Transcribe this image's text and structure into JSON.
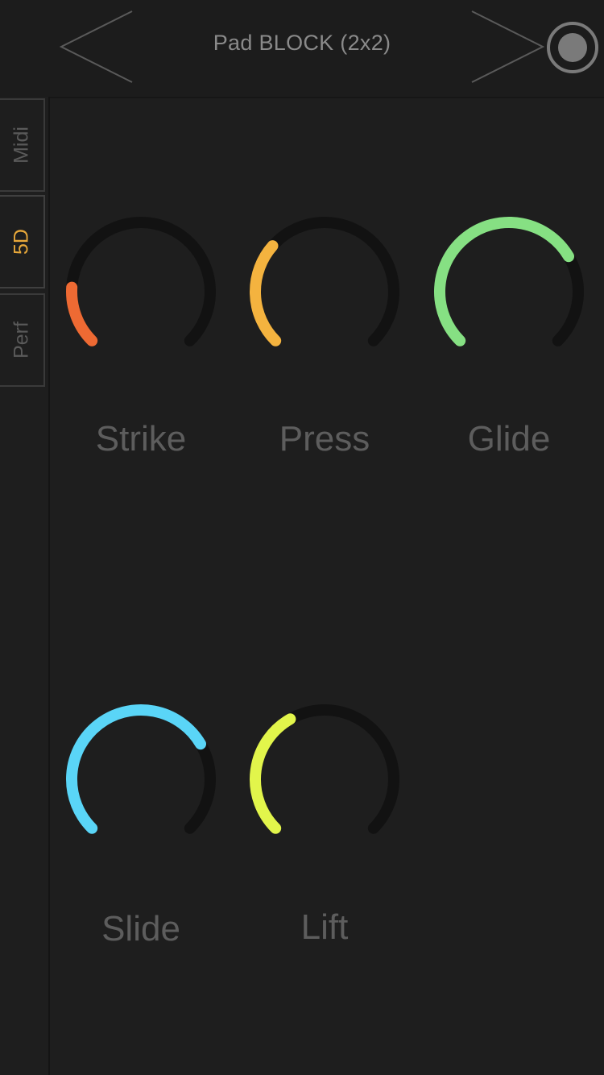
{
  "header": {
    "title": "Pad BLOCK (2x2)",
    "prev_icon": "chevron-left-icon",
    "next_icon": "chevron-right-icon",
    "record_icon": "record-icon"
  },
  "sidebar": {
    "tabs": [
      {
        "label": "Midi",
        "active": false
      },
      {
        "label": "5D",
        "active": true
      },
      {
        "label": "Perf",
        "active": false
      }
    ]
  },
  "colors": {
    "background": "#1e1e1e",
    "track": "#121212",
    "active_tab": "#e8a83a",
    "label": "#5d5d5d"
  },
  "knobs": [
    {
      "label": "Strike",
      "value": 0.18,
      "color": "#ee6a33"
    },
    {
      "label": "Press",
      "value": 0.32,
      "color": "#f4b33f"
    },
    {
      "label": "Glide",
      "value": 0.72,
      "color": "#86e083"
    },
    {
      "label": "Slide",
      "value": 0.72,
      "color": "#5ad5f7"
    },
    {
      "label": "Lift",
      "value": 0.39,
      "color": "#e2f54b"
    }
  ]
}
